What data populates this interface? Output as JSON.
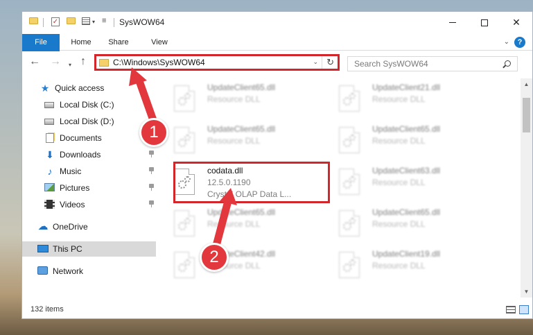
{
  "window": {
    "title": "SysWOW64"
  },
  "ribbon": {
    "tabs": [
      "File",
      "Home",
      "Share",
      "View"
    ]
  },
  "nav": {
    "address": "C:\\Windows\\SysWOW64",
    "search_placeholder": "Search SysWOW64"
  },
  "sidebar": {
    "items": [
      {
        "label": "Quick access",
        "icon": "quick-access-star-icon",
        "pinned": false
      },
      {
        "label": "Local Disk (C:)",
        "icon": "local-disk-icon",
        "pinned": true
      },
      {
        "label": "Local Disk (D:)",
        "icon": "local-disk-icon",
        "pinned": true
      },
      {
        "label": "Documents",
        "icon": "documents-icon",
        "pinned": true
      },
      {
        "label": "Downloads",
        "icon": "downloads-icon",
        "pinned": true
      },
      {
        "label": "Music",
        "icon": "music-icon",
        "pinned": true
      },
      {
        "label": "Pictures",
        "icon": "pictures-icon",
        "pinned": true
      },
      {
        "label": "Videos",
        "icon": "videos-icon",
        "pinned": true
      },
      {
        "label": "OneDrive",
        "icon": "onedrive-icon",
        "pinned": false
      },
      {
        "label": "This PC",
        "icon": "this-pc-icon",
        "pinned": false,
        "selected": true
      },
      {
        "label": "Network",
        "icon": "network-icon",
        "pinned": false
      }
    ]
  },
  "files": {
    "highlighted": {
      "name": "codata.dll",
      "version": "12.5.0.1190",
      "description": "Crystal OLAP Data L..."
    },
    "left_column": [
      {
        "name": "UpdateClient65.dll",
        "type": "Resource DLL"
      },
      {
        "name": "UpdateClient65.dll",
        "type": "Resource DLL"
      },
      {
        "name": "UpdateClient65.dll",
        "type": "Resource DLL"
      },
      {
        "name": "UpdateClient42.dll",
        "type": "Resource DLL"
      }
    ],
    "right_column": [
      {
        "name": "UpdateClient21.dll",
        "type": "Resource DLL"
      },
      {
        "name": "UpdateClient65.dll",
        "type": "Resource DLL"
      },
      {
        "name": "UpdateClient63.dll",
        "type": "Resource DLL"
      },
      {
        "name": "UpdateClient65.dll",
        "type": "Resource DLL"
      },
      {
        "name": "UpdateClient19.dll",
        "type": "Resource DLL"
      }
    ]
  },
  "status": {
    "item_count": "132 items"
  },
  "callouts": {
    "step1": "1",
    "step2": "2"
  },
  "colors": {
    "accent": "#1979ca",
    "highlight_red": "#d3262b",
    "callout_red": "#e2373d",
    "selected_nav": "#d9d9d9"
  }
}
